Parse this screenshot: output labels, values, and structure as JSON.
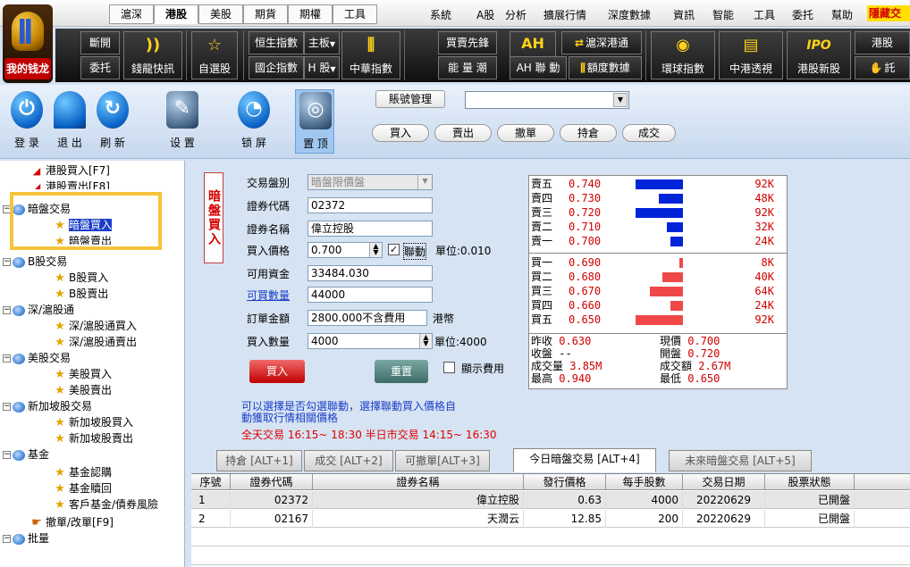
{
  "logo": {
    "label": "我的钱龙"
  },
  "topmenu": {
    "tabs": [
      "滬深",
      "港股",
      "美股",
      "期貨",
      "期權",
      "工具"
    ],
    "right": [
      "系統",
      "A股",
      "分析",
      "擴展行情",
      "深度數據",
      "資訊",
      "智能",
      "工具",
      "委托",
      "幫助"
    ],
    "hidden": "隱藏交"
  },
  "darkbar": {
    "b_dark1": "斷開",
    "b_dark2": "委托",
    "b_news": "錢龍快訊",
    "b_self": "自選股",
    "b_hsi": "恒生指數",
    "b_main": "主板",
    "b_hsce": "國企指數",
    "b_h": "H 股",
    "b_china": "中華指數",
    "b_bid": "買賣先鋒",
    "b_power": "能 量 潮",
    "b_hkconn": "滬深港通",
    "b_ah": "AH 聯 動",
    "b_quota": "額度數據",
    "b_global": "環球指數",
    "b_cnhk": "中港透視",
    "b_ipo": "港股新股",
    "b_edge1": "港股",
    "b_edge2": "託"
  },
  "iconbar": {
    "login": "登 录",
    "logout": "退 出",
    "refresh": "刷 新",
    "settings": "设 置",
    "lock": "锁 屏",
    "top": "置 顶",
    "acct_mgmt": "賬號管理",
    "buy": "買入",
    "sell": "賣出",
    "cancel": "撤單",
    "hold": "持倉",
    "done": "成交"
  },
  "tree": {
    "n0": "港股買入[F7]",
    "n1": "港股賣出[F8]",
    "n2": "暗盤交易",
    "n3": "暗盤買入",
    "n4": "暗盤賣出",
    "n5": "B股交易",
    "n6": "B股買入",
    "n7": "B股賣出",
    "n8": "深/滬股通",
    "n9": "深/滬股通買入",
    "n10": "深/滬股通賣出",
    "n11": "美股交易",
    "n12": "美股買入",
    "n13": "美股賣出",
    "n14": "新加坡股交易",
    "n15": "新加坡股買入",
    "n16": "新加坡股賣出",
    "n17": "基金",
    "n18": "基金認購",
    "n19": "基金贖回",
    "n20": "客戶基金/債券風險",
    "n21": "撤單/改單[F9]",
    "n22": "批量"
  },
  "form": {
    "vtitle": "暗盤買入",
    "type_label": "交易盤別",
    "type_value": "暗盤限價盤",
    "code_label": "證券代碼",
    "code_value": "02372",
    "name_label": "證券名稱",
    "name_value": "偉立控股",
    "price_label": "買入價格",
    "price_value": "0.700",
    "link_label": "聯動",
    "unit_price": "單位:0.010",
    "funds_label": "可用資金",
    "funds_value": "33484.030",
    "qty_avail_label": "可買數量",
    "qty_avail_value": "44000",
    "amount_label": "訂單金額",
    "amount_value": "2800.000不含費用",
    "currency": "港幣",
    "qty_label": "買入數量",
    "qty_value": "4000",
    "unit_qty": "單位:4000",
    "buy_btn": "買入",
    "reset_btn": "重置",
    "show_fee": "顯示費用",
    "note1": "可以選擇是否勾選聯動，選擇聯動買入價格自",
    "note2": "動獲取行情相關價格",
    "session": "全天交易 16:15~ 18:30   半日市交易 14:15~ 16:30"
  },
  "quote": {
    "asks": [
      {
        "name": "賣五",
        "price": "0.740",
        "size": "92K",
        "frac": 0.37
      },
      {
        "name": "賣四",
        "price": "0.730",
        "size": "48K",
        "frac": 0.19
      },
      {
        "name": "賣三",
        "price": "0.720",
        "size": "92K",
        "frac": 0.37
      },
      {
        "name": "賣二",
        "price": "0.710",
        "size": "32K",
        "frac": 0.13
      },
      {
        "name": "賣一",
        "price": "0.700",
        "size": "24K",
        "frac": 0.1
      }
    ],
    "bids": [
      {
        "name": "買一",
        "price": "0.690",
        "size": "8K",
        "frac": 0.03
      },
      {
        "name": "買二",
        "price": "0.680",
        "size": "40K",
        "frac": 0.16
      },
      {
        "name": "買三",
        "price": "0.670",
        "size": "64K",
        "frac": 0.26
      },
      {
        "name": "買四",
        "price": "0.660",
        "size": "24K",
        "frac": 0.1
      },
      {
        "name": "買五",
        "price": "0.650",
        "size": "92K",
        "frac": 0.37
      }
    ],
    "prev_close_label": "昨收",
    "prev_close": "0.630",
    "last_label": "現價",
    "last": "0.700",
    "close_label": "收盤",
    "close": "--",
    "open_label": "開盤",
    "open": "0.720",
    "vol_label": "成交量",
    "vol": "3.85M",
    "turnover_label": "成交額",
    "turnover": "2.67M",
    "high_label": "最高",
    "high": "0.940",
    "low_label": "最低",
    "low": "0.650",
    "ask_color": "#0024d8",
    "bid_color": "#f04848"
  },
  "tabs": [
    "持倉 [ALT+1]",
    "成交 [ALT+2]",
    "可撤單[ALT+3]",
    "今日暗盤交易 [ALT+4]",
    "未來暗盤交易 [ALT+5]"
  ],
  "table": {
    "headers": [
      "序號",
      "證券代碼",
      "證券名稱",
      "發行價格",
      "每手股數",
      "交易日期",
      "股票狀態"
    ],
    "rows": [
      [
        "1",
        "02372",
        "偉立控股",
        "0.63",
        "4000",
        "20220629",
        "已開盤"
      ],
      [
        "2",
        "02167",
        "天潤云",
        "12.85",
        "200",
        "20220629",
        "已開盤"
      ]
    ]
  }
}
